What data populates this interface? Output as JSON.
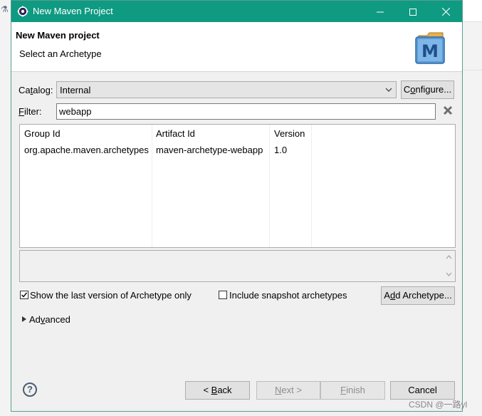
{
  "window": {
    "title": "New Maven Project"
  },
  "header": {
    "title": "New Maven project",
    "subtitle": "Select an Archetype",
    "logo_letter": "M"
  },
  "catalog": {
    "label_pre": "Ca",
    "label_key": "t",
    "label_post": "alog:",
    "selected": "Internal",
    "configure_pre": "C",
    "configure_key": "o",
    "configure_post": "nfigure..."
  },
  "filter": {
    "label_key": "F",
    "label_post": "ilter:",
    "value": "webapp"
  },
  "table": {
    "columns": [
      "Group Id",
      "Artifact Id",
      "Version"
    ],
    "rows": [
      [
        "org.apache.maven.archetypes",
        "maven-archetype-webapp",
        "1.0"
      ]
    ]
  },
  "options": {
    "show_last_version": "Show the last version of Archetype only",
    "show_last_version_checked": true,
    "include_snapshot": "Include snapshot archetypes",
    "include_snapshot_checked": false,
    "add_archetype_pre": "A",
    "add_archetype_key": "d",
    "add_archetype_post": "d Archetype..."
  },
  "advanced": {
    "label_pre": "Ad",
    "label_key": "v",
    "label_post": "anced"
  },
  "buttons": {
    "help": "?",
    "back_pre": "< ",
    "back_key": "B",
    "back_post": "ack",
    "next_key": "N",
    "next_post": "ext >",
    "finish_key": "F",
    "finish_post": "inish",
    "cancel": "Cancel"
  },
  "watermark": "CSDN @一路yl",
  "colors": {
    "titlebar": "#0f9a82",
    "accent_check": "#1a73e8"
  }
}
